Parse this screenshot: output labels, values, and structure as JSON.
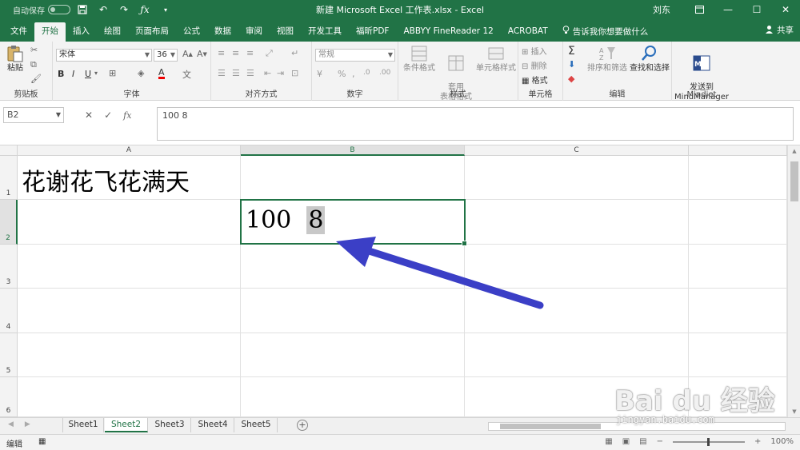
{
  "title_bar": {
    "autosave_label": "自动保存",
    "title": "新建 Microsoft Excel 工作表.xlsx  -  Excel",
    "user": "刘东"
  },
  "ribbon_tabs": [
    {
      "label": "文件"
    },
    {
      "label": "开始"
    },
    {
      "label": "插入"
    },
    {
      "label": "绘图"
    },
    {
      "label": "页面布局"
    },
    {
      "label": "公式"
    },
    {
      "label": "数据"
    },
    {
      "label": "审阅"
    },
    {
      "label": "视图"
    },
    {
      "label": "开发工具"
    },
    {
      "label": "福昕PDF"
    },
    {
      "label": "ABBYY FineReader 12"
    },
    {
      "label": "ACROBAT"
    }
  ],
  "active_tab": "开始",
  "tell_me": "告诉我你想要做什么",
  "share": "共享",
  "ribbon": {
    "clipboard": {
      "paste": "粘贴",
      "label": "剪贴板"
    },
    "font": {
      "name": "宋体",
      "size": "36",
      "label": "字体"
    },
    "alignment": {
      "label": "对齐方式"
    },
    "number": {
      "format": "常规",
      "label": "数字"
    },
    "styles": {
      "conditional": "条件格式",
      "table": "套用\n表格格式",
      "cell_styles": "单元格样式",
      "label": "样式"
    },
    "cells": {
      "insert": "插入",
      "delete": "删除",
      "format": "格式",
      "label": "单元格"
    },
    "editing": {
      "sort": "排序和筛选",
      "find": "查找和选择",
      "label": "编辑"
    },
    "mindjet": {
      "send": "发送到\nMindManager",
      "label": "Mindjet"
    }
  },
  "formula_bar": {
    "name_box": "B2",
    "formula": "100 8"
  },
  "columns": [
    "A",
    "B",
    "C"
  ],
  "rows": [
    "1",
    "2",
    "3",
    "4",
    "5",
    "6"
  ],
  "cells": {
    "A1": "花谢花飞花满天",
    "B2_part1": "100",
    "B2_part2": "8"
  },
  "sheets": [
    "Sheet1",
    "Sheet2",
    "Sheet3",
    "Sheet4",
    "Sheet5"
  ],
  "active_sheet": "Sheet2",
  "status": {
    "mode": "编辑",
    "zoom": "100%"
  },
  "watermark": {
    "brand": "Bai du 经验",
    "url": "jingyan.baidu.com"
  },
  "colors": {
    "excel_green": "#217346",
    "arrow": "#3b3fc6"
  }
}
